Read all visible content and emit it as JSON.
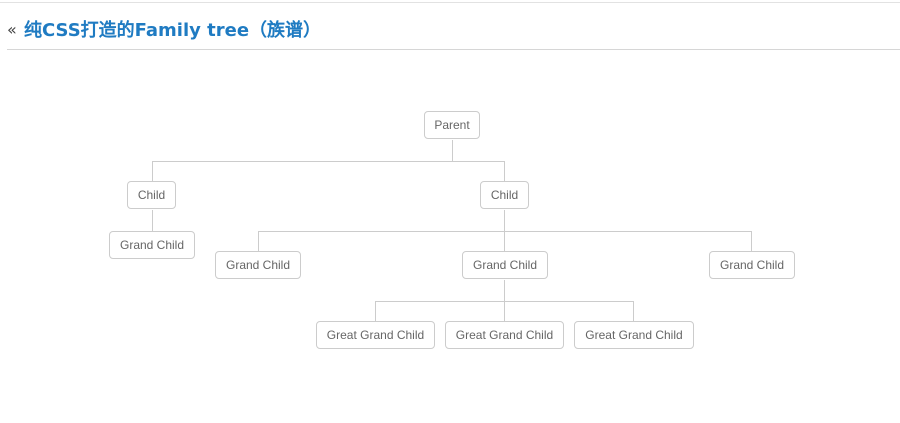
{
  "header": {
    "back_icon": "«",
    "title": "纯CSS打造的Family tree（族谱）"
  },
  "tree": {
    "parent": "Parent",
    "child_1": "Child",
    "child_2": "Child",
    "child_1_grand_child": "Grand Child",
    "child_2_grand_child_1": "Grand Child",
    "child_2_grand_child_2": "Grand Child",
    "child_2_grand_child_3": "Grand Child",
    "great_grand_child_1": "Great Grand Child",
    "great_grand_child_2": "Great Grand Child",
    "great_grand_child_3": "Great Grand Child"
  }
}
